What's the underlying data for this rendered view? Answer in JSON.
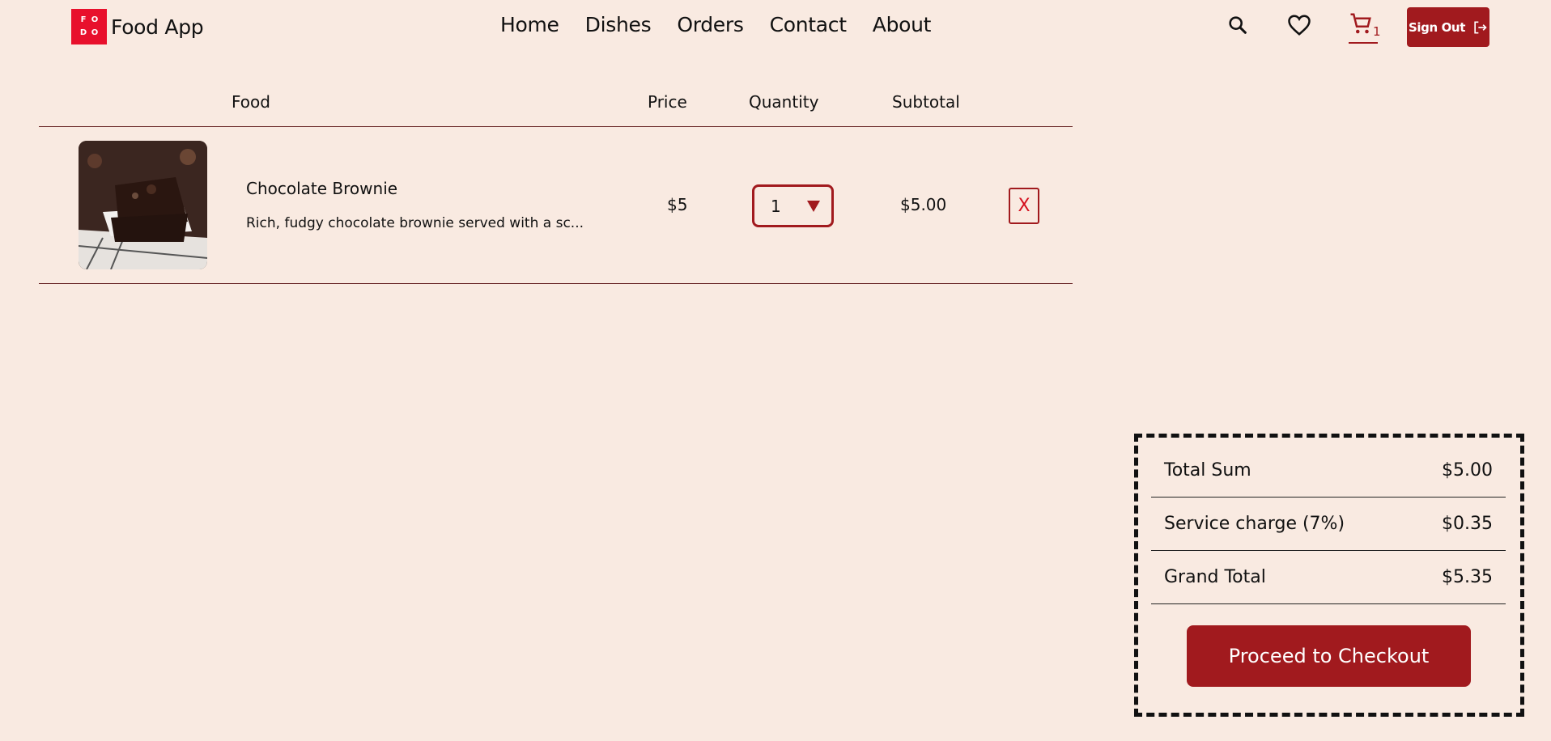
{
  "header": {
    "logo_letters": [
      "F",
      "O",
      "D",
      "O"
    ],
    "app_name": "Food App",
    "nav": [
      "Home",
      "Dishes",
      "Orders",
      "Contact",
      "About"
    ],
    "icons": [
      "search-icon",
      "heart-icon",
      "cart-icon"
    ],
    "cart_count": "1",
    "signout_label": "Sign Out",
    "accent_color": "#a11a1e",
    "logo_color": "#e8102c"
  },
  "table": {
    "columns": [
      "Food",
      "Price",
      "Quantity",
      "Subtotal"
    ],
    "rows": [
      {
        "name": "Chocolate Brownie",
        "description": "Rich, fudgy chocolate brownie served with a sc...",
        "price": "$5",
        "quantity": "1",
        "subtotal": "$5.00",
        "remove_label": "X"
      }
    ]
  },
  "summary": {
    "rows": [
      {
        "label": "Total Sum",
        "value": "$5.00"
      },
      {
        "label": "Service charge (7%)",
        "value": "$0.35"
      },
      {
        "label": "Grand Total",
        "value": "$5.35"
      }
    ],
    "checkout_label": "Proceed to Checkout"
  }
}
